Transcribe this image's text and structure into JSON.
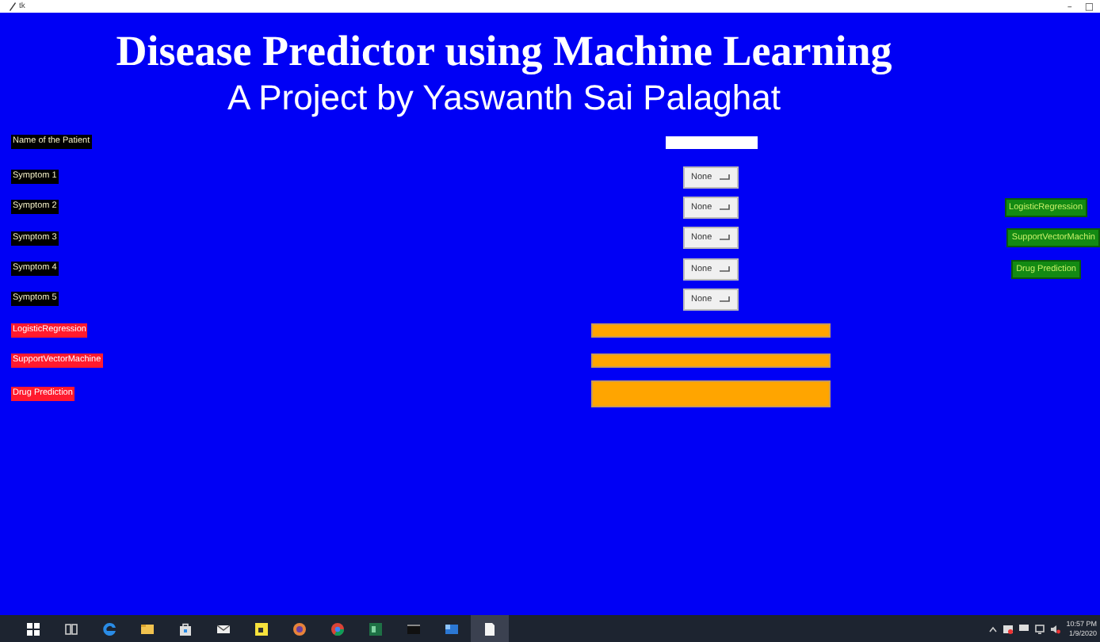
{
  "window": {
    "title": "tk",
    "controls": [
      "–",
      "□"
    ]
  },
  "heading": "Disease Predictor using Machine Learning",
  "subheading": "A Project by Yaswanth Sai Palaghat",
  "rows": [
    {
      "kind": "entry",
      "label": "Name of the Patient"
    },
    {
      "kind": "combo",
      "label": "Symptom 1",
      "value": "None"
    },
    {
      "kind": "combo",
      "label": "Symptom 2",
      "value": "None",
      "button": "LogisticRegression"
    },
    {
      "kind": "combo",
      "label": "Symptom 3",
      "value": "None",
      "button": "SupportVectorMachin"
    },
    {
      "kind": "combo",
      "label": "Symptom 4",
      "value": "None",
      "button": "Drug Prediction"
    },
    {
      "kind": "combo",
      "label": "Symptom 5",
      "value": "None"
    },
    {
      "kind": "result",
      "label": "LogisticRegression"
    },
    {
      "kind": "result",
      "label": "SupportVectorMachine"
    },
    {
      "kind": "result",
      "label": "Drug Prediction",
      "tall": true
    }
  ],
  "taskbar": {
    "time": "10:57 PM",
    "date": "1/9/2020"
  }
}
